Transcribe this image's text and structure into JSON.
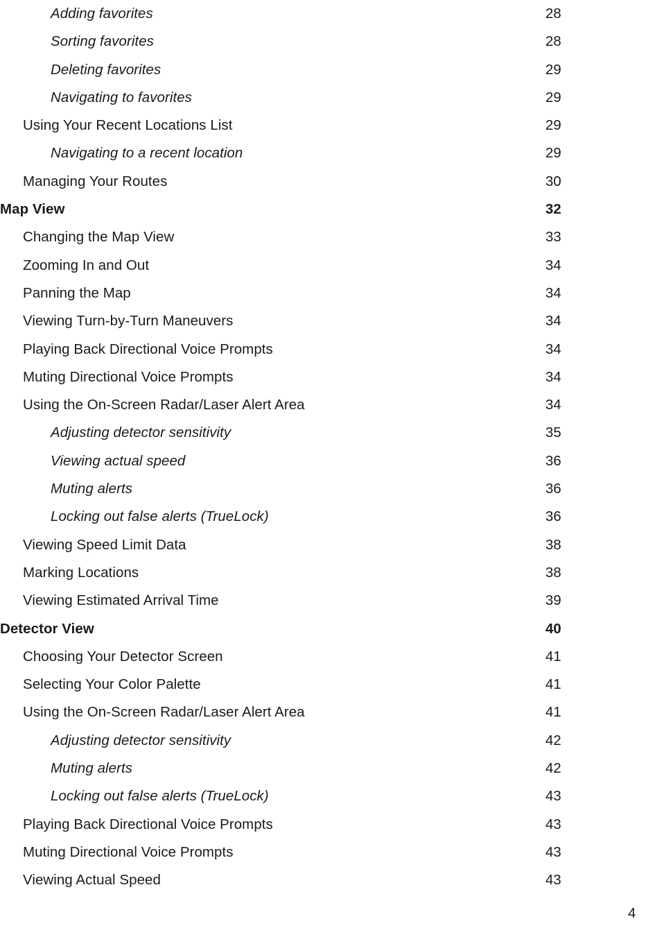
{
  "document": {
    "page_number": "4",
    "text_color": "#1a1a1a",
    "background_color": "#ffffff"
  },
  "toc": {
    "entries": [
      {
        "title": "Adding favorites",
        "page": "28",
        "level": 2
      },
      {
        "title": "Sorting favorites",
        "page": "28",
        "level": 2
      },
      {
        "title": "Deleting favorites",
        "page": "29",
        "level": 2
      },
      {
        "title": "Navigating to favorites",
        "page": "29",
        "level": 2
      },
      {
        "title": "Using Your Recent Locations List",
        "page": "29",
        "level": 1
      },
      {
        "title": "Navigating to a recent location",
        "page": "29",
        "level": 2
      },
      {
        "title": "Managing Your Routes",
        "page": "30",
        "level": 1
      },
      {
        "title": "Map View",
        "page": "32",
        "level": 0
      },
      {
        "title": "Changing the Map View",
        "page": "33",
        "level": 1
      },
      {
        "title": "Zooming In and Out",
        "page": "34",
        "level": 1
      },
      {
        "title": "Panning the Map",
        "page": "34",
        "level": 1
      },
      {
        "title": "Viewing Turn-by-Turn Maneuvers",
        "page": "34",
        "level": 1
      },
      {
        "title": "Playing Back Directional Voice Prompts",
        "page": "34",
        "level": 1
      },
      {
        "title": "Muting Directional Voice Prompts",
        "page": "34",
        "level": 1
      },
      {
        "title": "Using the On-Screen Radar/Laser Alert Area",
        "page": "34",
        "level": 1
      },
      {
        "title": "Adjusting detector sensitivity",
        "page": "35",
        "level": 2
      },
      {
        "title": "Viewing actual speed",
        "page": "36",
        "level": 2
      },
      {
        "title": "Muting alerts",
        "page": "36",
        "level": 2
      },
      {
        "title": "Locking out false alerts (TrueLock)",
        "page": "36",
        "level": 2
      },
      {
        "title": "Viewing Speed Limit Data",
        "page": "38",
        "level": 1
      },
      {
        "title": "Marking Locations",
        "page": "38",
        "level": 1
      },
      {
        "title": "Viewing Estimated Arrival Time",
        "page": "39",
        "level": 1
      },
      {
        "title": "Detector View",
        "page": "40",
        "level": 0
      },
      {
        "title": "Choosing Your Detector Screen",
        "page": "41",
        "level": 1
      },
      {
        "title": "Selecting Your Color Palette",
        "page": "41",
        "level": 1
      },
      {
        "title": "Using the On-Screen Radar/Laser Alert Area",
        "page": "41",
        "level": 1
      },
      {
        "title": "Adjusting detector sensitivity",
        "page": "42",
        "level": 2
      },
      {
        "title": "Muting alerts",
        "page": "42",
        "level": 2
      },
      {
        "title": "Locking out false alerts (TrueLock)",
        "page": "43",
        "level": 2
      },
      {
        "title": "Playing Back Directional Voice Prompts",
        "page": "43",
        "level": 1
      },
      {
        "title": "Muting Directional Voice Prompts",
        "page": "43",
        "level": 1
      },
      {
        "title": "Viewing Actual Speed",
        "page": "43",
        "level": 1
      }
    ]
  }
}
